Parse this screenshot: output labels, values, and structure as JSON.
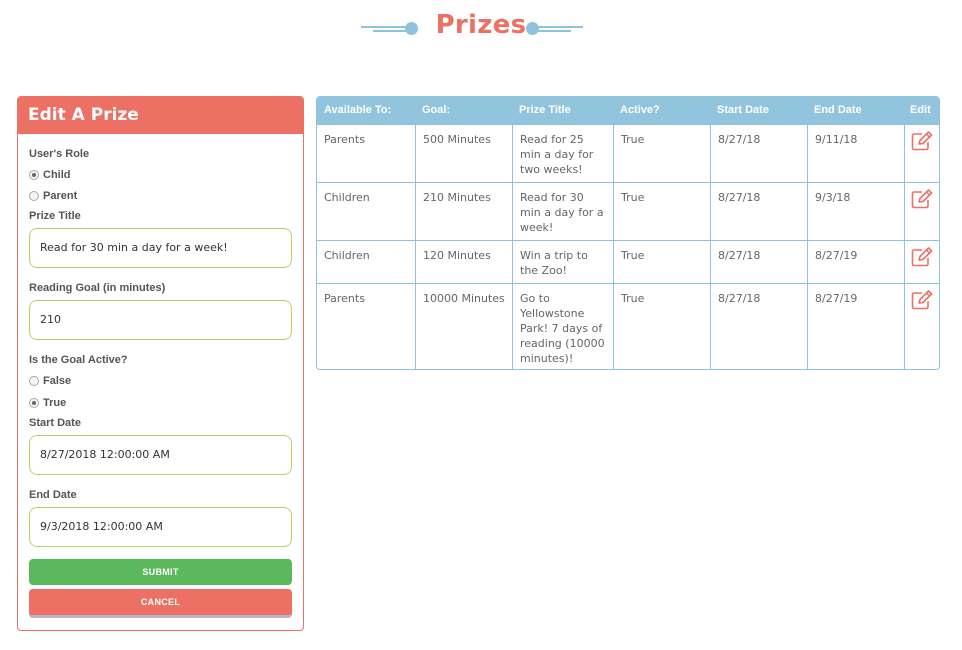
{
  "colors": {
    "brand": "#ec7063",
    "accent": "#92c5dd",
    "success": "#5cb85c",
    "field_border": "#b5d46a"
  },
  "header": {
    "title": "Prizes"
  },
  "edit_form": {
    "title": "Edit A Prize",
    "role_label": "User's Role",
    "role_options": [
      {
        "label": "Child",
        "checked": true
      },
      {
        "label": "Parent",
        "checked": false
      }
    ],
    "prize_title_label": "Prize Title",
    "prize_title_value": "Read for 30 min a day for a week!",
    "goal_label": "Reading Goal (in minutes)",
    "goal_value": "210",
    "active_label": "Is the Goal Active?",
    "active_options": [
      {
        "label": "False",
        "checked": false
      },
      {
        "label": "True",
        "checked": true
      }
    ],
    "start_label": "Start Date",
    "start_value": "8/27/2018 12:00:00 AM",
    "end_label": "End Date",
    "end_value": "9/3/2018 12:00:00 AM",
    "submit_label": "SUBMIT",
    "cancel_label": "CANCEL"
  },
  "table": {
    "headers": [
      "Available To:",
      "Goal:",
      "Prize Title",
      "Active?",
      "Start Date",
      "End Date",
      "Edit"
    ],
    "edit_icon": "pencil-square-icon",
    "rows": [
      [
        "Parents",
        "500 Minutes",
        "Read for 25 min a day for two weeks!",
        "True",
        "8/27/18",
        "9/11/18"
      ],
      [
        "Children",
        "210 Minutes",
        "Read for 30 min a day for a week!",
        "True",
        "8/27/18",
        "9/3/18"
      ],
      [
        "Children",
        "120 Minutes",
        "Win a trip to the Zoo!",
        "True",
        "8/27/18",
        "8/27/19"
      ],
      [
        "Parents",
        "10000 Minutes",
        "Go to Yellowstone Park! 7 days of reading (10000 minutes)!",
        "True",
        "8/27/18",
        "8/27/19"
      ]
    ]
  }
}
